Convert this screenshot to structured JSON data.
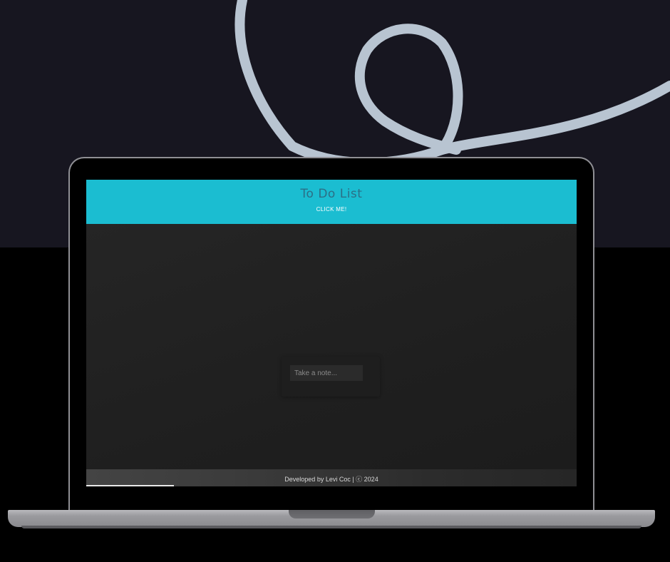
{
  "app": {
    "title": "To Do List",
    "click_label": "CLICK ME!"
  },
  "note": {
    "placeholder": "Take a note..."
  },
  "footer": {
    "text": "Developed by Levi Coc | ⓒ 2024"
  },
  "colors": {
    "header": "#1bbdd1",
    "title": "#2c6f86",
    "body": "#202020",
    "backdrop": "#171620",
    "squiggle": "#b8c4d1"
  }
}
